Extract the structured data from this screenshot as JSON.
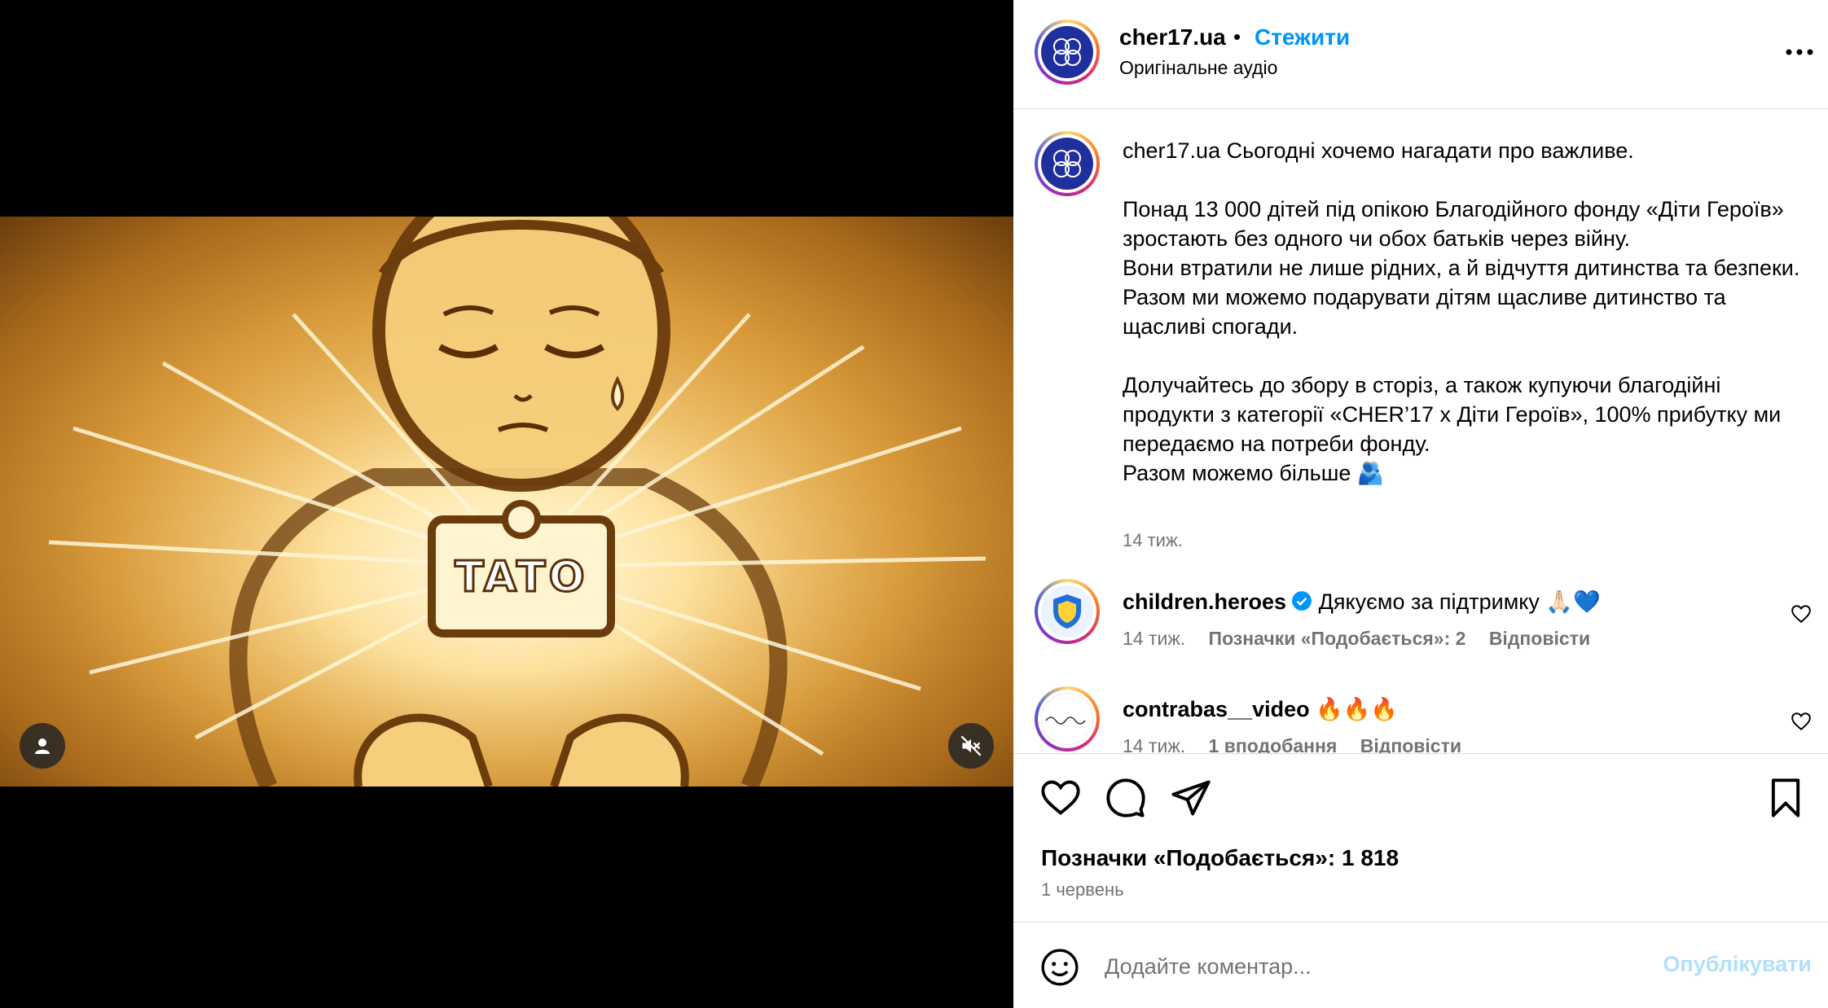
{
  "post": {
    "username": "cher17.ua",
    "follow_label": "Стежити",
    "separator": "•",
    "audio": "Оригінальне аудіо",
    "media_sign_text": "TATO"
  },
  "caption": {
    "username": "cher17.ua",
    "lines": [
      "Сьогодні хочемо нагадати про важливе.",
      "",
      "Понад 13 000 дітей під опікою Благодійного фонду «Діти Героїв» зростають без одного чи обох батьків через війну.",
      "Вони втратили не лише рідних, а й відчуття дитинства та безпеки.",
      "Разом ми можемо подарувати дітям щасливе дитинство та щасливі спогади.",
      "",
      "Долучайтесь до збору в сторіз, а також купуючи благодійні продукти з категорії «CHER’17 x Діти Героїв», 100% прибутку ми передаємо на потреби фонду.",
      "Разом можемо більше 🫂"
    ],
    "time": "14 тиж."
  },
  "comments": [
    {
      "username": "children.heroes",
      "text": "Дякуємо за підтримку 🙏🏻💙",
      "time": "14 тиж.",
      "likes": "Позначки «Подобається»: 2",
      "reply": "Відповісти"
    },
    {
      "username": "contrabas__video",
      "text": "🔥🔥🔥",
      "time": "14 тиж.",
      "likes": "1 вподобання",
      "reply": "Відповісти"
    }
  ],
  "stats": {
    "likes": "Позначки «Подобається»: 1 818",
    "date": "1 червень"
  },
  "composer": {
    "placeholder": "Додайте коментар...",
    "publish_label": "Опублікувати"
  },
  "colors": {
    "accent": "#0095f6",
    "publish_disabled": "#b2dffc",
    "muted": "#737373"
  }
}
